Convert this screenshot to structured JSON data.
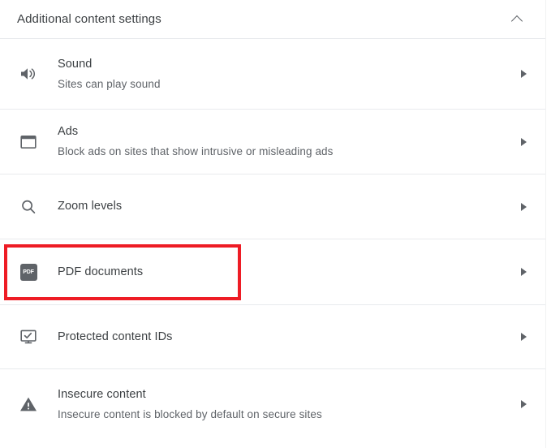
{
  "header": {
    "title": "Additional content settings",
    "collapse_icon": "chevron-up-icon"
  },
  "rows": [
    {
      "id": "sound",
      "icon": "volume-up-icon",
      "title": "Sound",
      "subtitle": "Sites can play sound",
      "arrow_icon": "chevron-right-icon",
      "highlighted": false
    },
    {
      "id": "ads",
      "icon": "ad-window-icon",
      "title": "Ads",
      "subtitle": "Block ads on sites that show intrusive or misleading ads",
      "arrow_icon": "chevron-right-icon",
      "highlighted": false
    },
    {
      "id": "zoom-levels",
      "icon": "search-icon",
      "title": "Zoom levels",
      "subtitle": "",
      "arrow_icon": "chevron-right-icon",
      "highlighted": false
    },
    {
      "id": "pdf-documents",
      "icon": "pdf-icon",
      "icon_label": "PDF",
      "title": "PDF documents",
      "subtitle": "",
      "arrow_icon": "chevron-right-icon",
      "highlighted": true
    },
    {
      "id": "protected-content-ids",
      "icon": "monitor-check-icon",
      "title": "Protected content IDs",
      "subtitle": "",
      "arrow_icon": "chevron-right-icon",
      "highlighted": false
    },
    {
      "id": "insecure-content",
      "icon": "warning-triangle-icon",
      "title": "Insecure content",
      "subtitle": "Insecure content is blocked by default on secure sites",
      "arrow_icon": "chevron-right-icon",
      "highlighted": false
    }
  ],
  "colors": {
    "highlight": "#ee1c25",
    "text_primary": "#3c4043",
    "text_secondary": "#5f6368",
    "divider": "#e8eaed",
    "background": "#ffffff"
  }
}
